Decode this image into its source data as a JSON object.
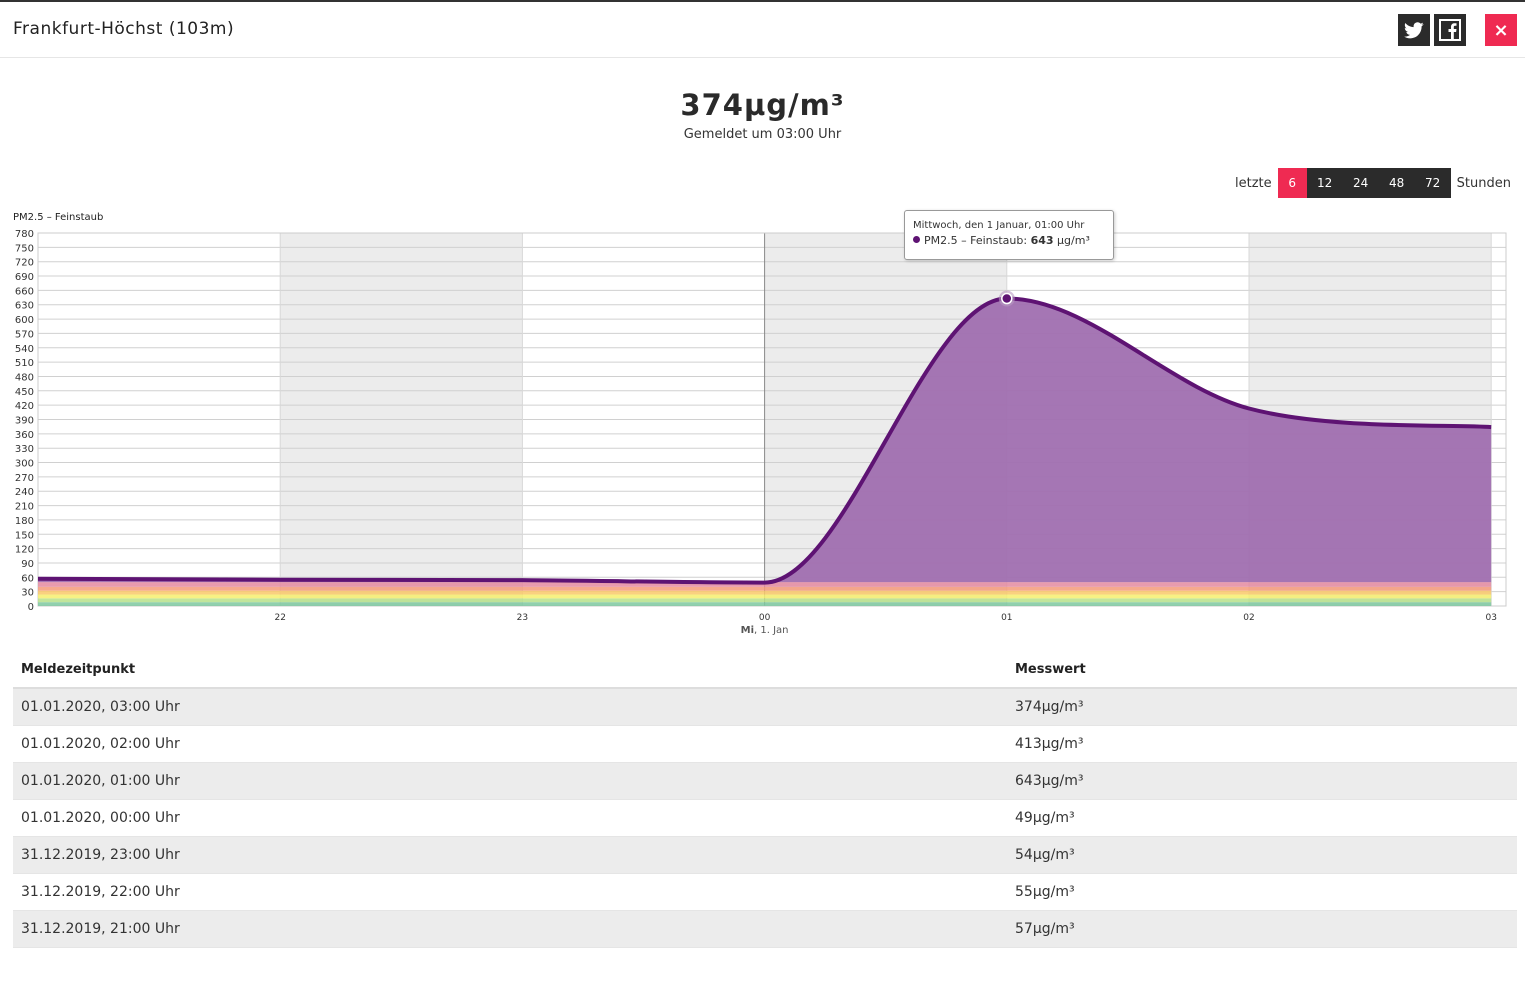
{
  "header": {
    "title": "Frankfurt-Höchst (103m)",
    "close_label": "×"
  },
  "summary": {
    "value": "374µg/m³",
    "reported": "Gemeldet um 03:00 Uhr"
  },
  "range": {
    "prefix": "letzte",
    "suffix": "Stunden",
    "options": [
      "6",
      "12",
      "24",
      "48",
      "72"
    ],
    "selected": "6"
  },
  "tooltip": {
    "line1": "Mittwoch, den 1 Januar, 01:00 Uhr",
    "series": "PM2.5 – Feinstaub:",
    "value": "643",
    "unit": "µg/m³"
  },
  "chart_data": {
    "type": "area",
    "title": "PM2.5 – Feinstaub",
    "x": [
      "21",
      "22",
      "23",
      "00",
      "01",
      "02",
      "03"
    ],
    "x_tick_labels": [
      "22",
      "23",
      "00",
      "01",
      "02",
      "03"
    ],
    "date_label_bold": "Mi",
    "date_label": ", 1. Jan",
    "series": [
      {
        "name": "PM2.5 – Feinstaub",
        "values": [
          57,
          55,
          54,
          49,
          643,
          413,
          374
        ]
      }
    ],
    "ylim": [
      0,
      780
    ],
    "y_ticks": [
      0,
      30,
      60,
      90,
      120,
      150,
      180,
      210,
      240,
      270,
      300,
      330,
      360,
      390,
      420,
      450,
      480,
      510,
      540,
      570,
      600,
      630,
      660,
      690,
      720,
      750,
      780
    ],
    "grid": true,
    "colors": {
      "line": "#5e1373",
      "fill": "#a06fb0",
      "band_grey": "#ececec"
    }
  },
  "table": {
    "headers": [
      "Meldezeitpunkt",
      "Messwert"
    ],
    "rows": [
      [
        "01.01.2020, 03:00 Uhr",
        "374µg/m³"
      ],
      [
        "01.01.2020, 02:00 Uhr",
        "413µg/m³"
      ],
      [
        "01.01.2020, 01:00 Uhr",
        "643µg/m³"
      ],
      [
        "01.01.2020, 00:00 Uhr",
        "49µg/m³"
      ],
      [
        "31.12.2019, 23:00 Uhr",
        "54µg/m³"
      ],
      [
        "31.12.2019, 22:00 Uhr",
        "55µg/m³"
      ],
      [
        "31.12.2019, 21:00 Uhr",
        "57µg/m³"
      ]
    ]
  }
}
